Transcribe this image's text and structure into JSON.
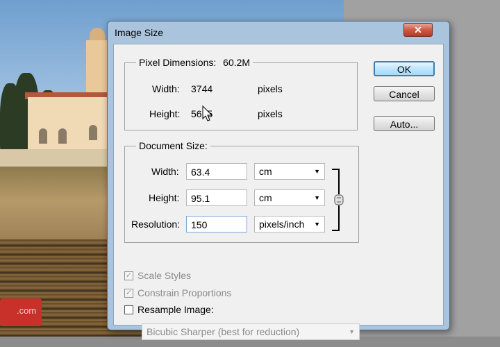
{
  "background": {
    "watermark": ".com"
  },
  "dialog": {
    "title": "Image Size",
    "close_glyph": "✕",
    "pixel_dimensions": {
      "label": "Pixel Dimensions:",
      "size": "60.2M",
      "width_label": "Width:",
      "width_value": "3744",
      "width_unit": "pixels",
      "height_label": "Height:",
      "height_value": "56  5",
      "height_unit": "pixels"
    },
    "document_size": {
      "label": "Document Size:",
      "width_label": "Width:",
      "width_value": "63.4",
      "width_unit": "cm",
      "height_label": "Height:",
      "height_value": "95.1",
      "height_unit": "cm",
      "resolution_label": "Resolution:",
      "resolution_value": "150",
      "resolution_unit": "pixels/inch"
    },
    "options": {
      "scale_styles": "Scale Styles",
      "scale_styles_checked": true,
      "constrain_proportions": "Constrain Proportions",
      "constrain_proportions_checked": true,
      "resample_image": "Resample Image:",
      "resample_image_checked": false,
      "resample_method": "Bicubic Sharper (best for reduction)"
    },
    "buttons": {
      "ok": "OK",
      "cancel": "Cancel",
      "auto": "Auto..."
    },
    "check_glyph": "✓",
    "dropdown_glyph": "▼",
    "icons": {
      "chain": "chain-link-icon",
      "cursor": "mouse-cursor-icon"
    }
  }
}
